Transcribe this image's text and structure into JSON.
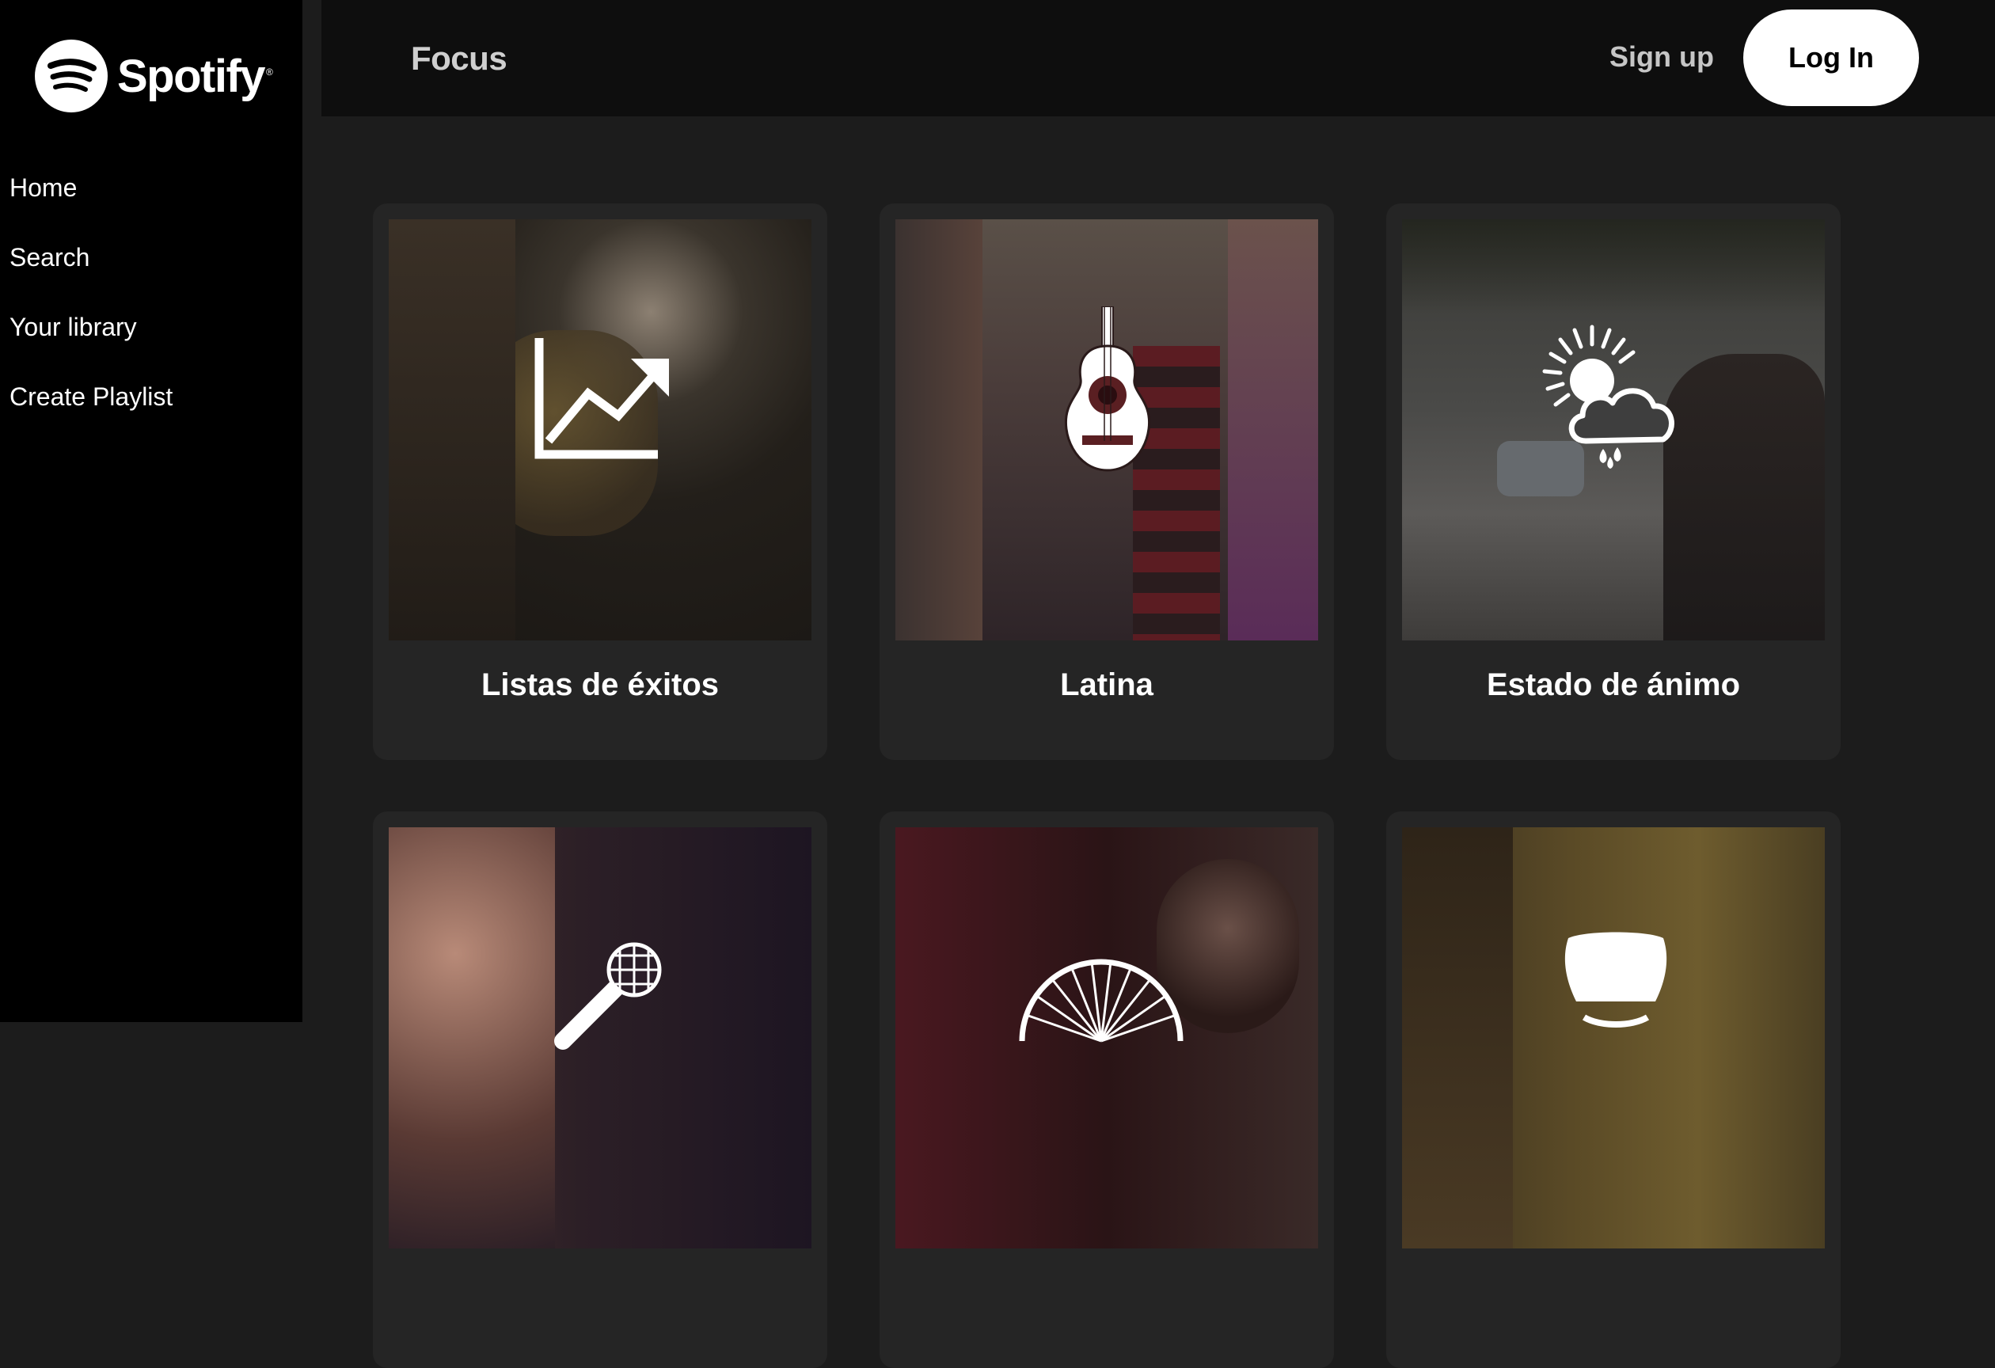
{
  "app": {
    "name": "Spotify"
  },
  "sidebar": {
    "items": [
      {
        "label": "Home"
      },
      {
        "label": "Search"
      },
      {
        "label": "Your library"
      },
      {
        "label": "Create Playlist"
      }
    ]
  },
  "header": {
    "title": "Focus",
    "signup_label": "Sign up",
    "login_label": "Log In"
  },
  "categories": [
    {
      "label": "Listas de éxitos",
      "icon": "chart-trending-up-icon"
    },
    {
      "label": "Latina",
      "icon": "guitar-icon"
    },
    {
      "label": "Estado de ánimo",
      "icon": "weather-sun-cloud-rain-icon"
    },
    {
      "label": "",
      "icon": "microphone-icon"
    },
    {
      "label": "",
      "icon": "fan-icon"
    },
    {
      "label": "",
      "icon": "armchair-icon"
    }
  ],
  "colors": {
    "sidebar_bg": "#000000",
    "header_bg": "#0e0e0e",
    "page_bg": "#1c1c1c",
    "card_bg": "#252525",
    "login_bg": "#ffffff"
  }
}
